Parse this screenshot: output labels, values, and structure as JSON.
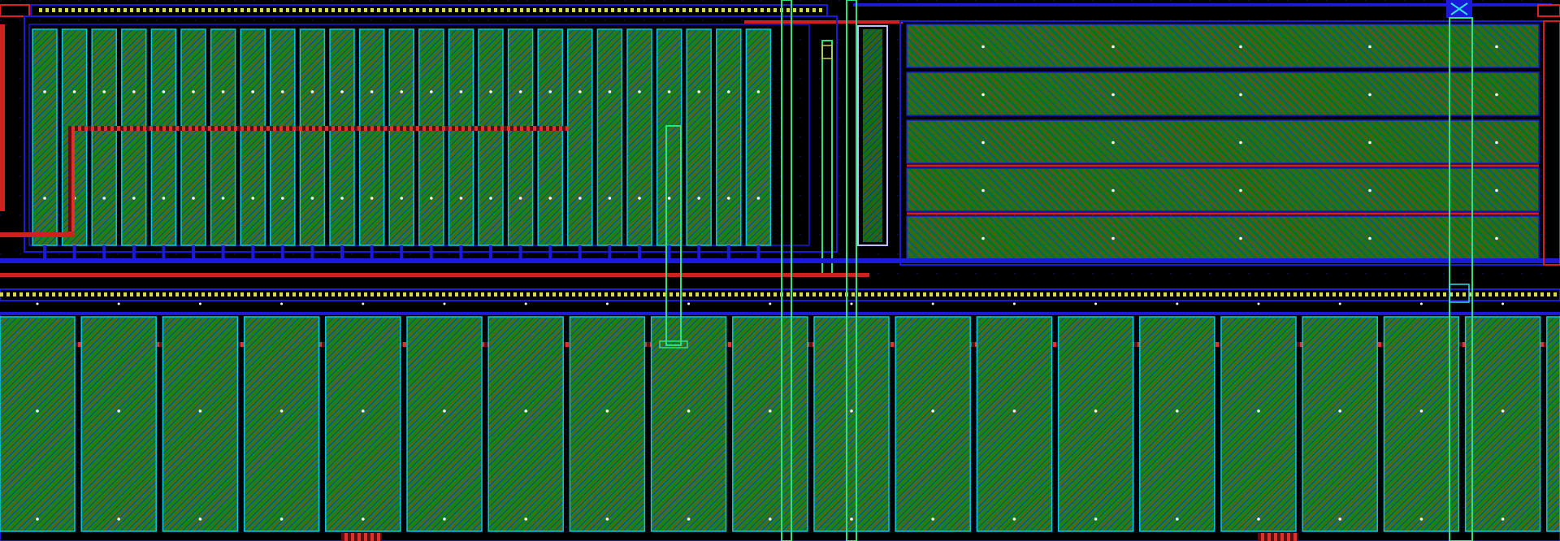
{
  "view": {
    "background": "#000000",
    "description_colors": {
      "diffusion": "#118a11",
      "diffusion_hatch": "#d92020",
      "metal1": "#1a1ad8",
      "metal2": "#00c8e0",
      "poly": "#e02020",
      "via": "#30e080",
      "implant": "#d0d050",
      "contact_dot": "#ffffff"
    }
  },
  "layout": {
    "upper_left_array": {
      "finger_count": 25
    },
    "upper_right_array": {
      "bar_count": 5
    },
    "lower_array": {
      "finger_count": 19
    }
  }
}
